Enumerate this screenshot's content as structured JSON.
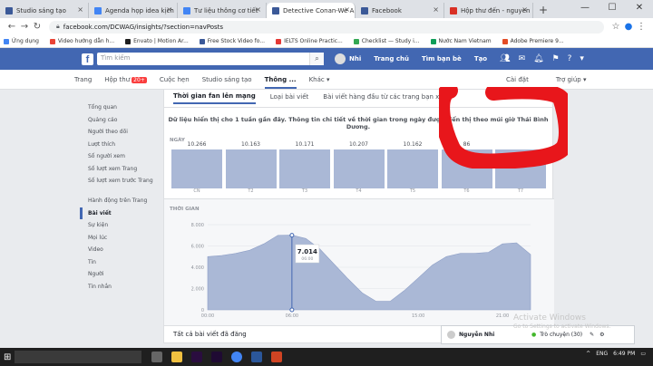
{
  "browser": {
    "tabs": [
      {
        "label": "Studio sáng tạo",
        "color": "#3b5998"
      },
      {
        "label": "Agenda họp idea kịch",
        "color": "#4285f4"
      },
      {
        "label": "Tư liệu thông cơ tiết",
        "color": "#4285f4"
      },
      {
        "label": "Detective Conan-We A",
        "color": "#3b5998"
      },
      {
        "label": "Facebook",
        "color": "#3b5998"
      },
      {
        "label": "Hộp thư đến - nguyen",
        "color": "#d93025"
      }
    ],
    "url": "facebook.com/DCWAG/insights/?section=navPosts",
    "bookmarks": [
      "Ứng dụng",
      "Video hướng dẫn h...",
      "Envato | Motion Ar...",
      "Free Stock Video fo...",
      "IELTS Online Practic...",
      "Checklist — Study i...",
      "Nước Nam Vietnam",
      "Adobe Premiere 9..."
    ]
  },
  "fb": {
    "logo": "f",
    "search_placeholder": "Tìm kiếm",
    "user": "Nhi",
    "nav": [
      "Trang chủ",
      "Tìm bạn bè",
      "Tạo"
    ]
  },
  "pagenav": {
    "items": [
      "Trang",
      "Hộp thư",
      "Cuộc hẹn",
      "Studio sáng tạo",
      "Thông ...",
      "Khác"
    ],
    "badge": "20+",
    "right": [
      "Cài đặt",
      "Trợ giúp"
    ]
  },
  "sidebar": [
    "Tổng quan",
    "Quảng cáo",
    "Người theo dõi",
    "Lượt thích",
    "Số người xem",
    "Số lượt xem Trang",
    "Số lượt xem trước Trang",
    "Hành động trên Trang",
    "Bài viết",
    "Sự kiện",
    "Mọi lúc",
    "Video",
    "Tin",
    "Người",
    "Tin nhắn"
  ],
  "subtabs": [
    "Thời gian fan lên mạng",
    "Loại bài viết",
    "Bài viết hàng đầu từ các trang bạn xem"
  ],
  "notice": "Dữ liệu hiển thị cho 1 tuần gần đây. Thông tin chi tiết về thời gian trong ngày được hiển thị theo múi giờ Thái Bình Dương.",
  "days_title": "NGÀY",
  "hours_title": "THỜI GIAN",
  "chart_data": [
    {
      "type": "bar",
      "categories": [
        "CN",
        "T2",
        "T3",
        "T4",
        "T5",
        "T6",
        "T7"
      ],
      "values": [
        10266,
        10163,
        10171,
        10207,
        10162,
        10086,
        10136
      ],
      "value_labels": [
        "10.266",
        "10.163",
        "10.171",
        "10.207",
        "10.162",
        "86",
        ""
      ]
    },
    {
      "type": "area",
      "x": [
        0,
        1,
        2,
        3,
        4,
        5,
        6,
        7,
        8,
        9,
        10,
        11,
        12,
        13,
        14,
        15,
        16,
        17,
        18,
        19,
        20,
        21,
        22,
        23
      ],
      "values": [
        5000,
        5100,
        5300,
        5600,
        6200,
        7000,
        7014,
        6700,
        5700,
        4300,
        2900,
        1600,
        800,
        800,
        1800,
        3000,
        4200,
        5000,
        5300,
        5300,
        5400,
        6200,
        6300,
        5200
      ],
      "x_tick_labels": [
        "00:00",
        "06:00",
        "15:00",
        "21:00"
      ],
      "y_tick_labels": [
        "8.000",
        "6.000",
        "4.000",
        "2.000",
        "0"
      ],
      "ylim": [
        0,
        8000
      ],
      "tooltip": {
        "value": "7.014",
        "time": "06:00"
      }
    }
  ],
  "bottom": {
    "label": "Tất cả bài viết đã đăng"
  },
  "chat": {
    "name": "Nguyễn Nhi",
    "status": "Trò chuyện (30)"
  },
  "watermark": {
    "line1": "Activate Windows",
    "line2": "Go to Settings to activate Windows."
  },
  "taskbar": {
    "search": "",
    "time": "6:49 PM",
    "lang": "ENG"
  },
  "colors": {
    "fb_blue": "#4267b2",
    "bar": "#aab8d6",
    "annotation_red": "#e8161b"
  }
}
